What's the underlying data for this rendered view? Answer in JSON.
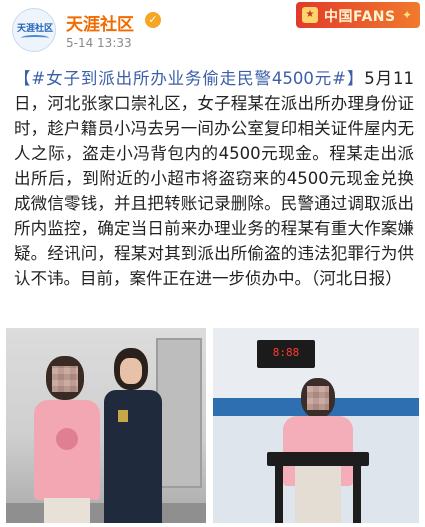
{
  "header": {
    "avatar_text": "天涯社区",
    "user_name": "天涯社区",
    "post_time": "5-14 13:33",
    "fans_badge": "中国FANS"
  },
  "post": {
    "topic": "【#女子到派出所办业务偷走民警4500元#】",
    "text": "5月11日，河北张家口崇礼区，女子程某在派出所办理身份证时，趁户籍员小冯去另一间办公室复印相关证件屋内无人之际，盗走小冯背包内的4500元现金。程某走出派出所后，到附近的小超市将盗窃来的4500元现金兑换成微信零钱，并且把转账记录删除。民警通过调取派出所内监控，确定当日前来办理业务的程某有重大作案嫌疑。经讯问，程某对其到派出所偷盗的违法犯罪行为供认不讳。目前，案件正在进一步侦办中。（河北日报）"
  },
  "photos": {
    "clock_digits": "8:88"
  },
  "icons": {
    "verified": "verified-icon",
    "fans": "fans-badge-icon"
  },
  "colors": {
    "user_name": "#f26b00",
    "topic": "#3b5fa8",
    "badge": "#e23a2a"
  }
}
